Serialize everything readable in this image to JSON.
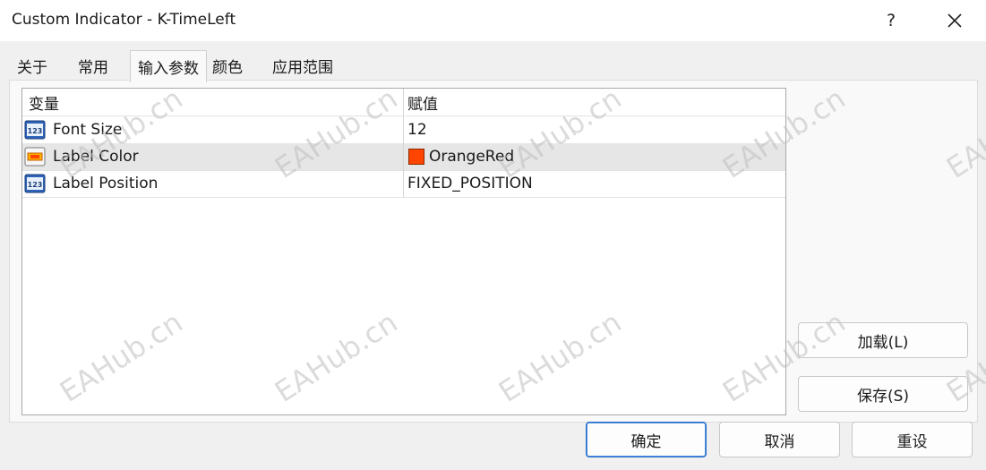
{
  "window": {
    "title": "Custom Indicator - K-TimeLeft",
    "help_label": "?"
  },
  "tabs": [
    {
      "label": "关于"
    },
    {
      "label": "常用"
    },
    {
      "label": "输入参数"
    },
    {
      "label": "颜色"
    },
    {
      "label": "应用范围"
    }
  ],
  "grid": {
    "columns": [
      "变量",
      "赋值"
    ],
    "rows": [
      {
        "name": "Font Size",
        "value": "12",
        "icon": "number-param-icon"
      },
      {
        "name": "Label Color",
        "value": "OrangeRed",
        "icon": "color-param-icon",
        "swatch": "#ff4500"
      },
      {
        "name": "Label Position",
        "value": "FIXED_POSITION",
        "icon": "number-param-icon"
      }
    ]
  },
  "side_buttons": {
    "load": "加载(L)",
    "save": "保存(S)"
  },
  "footer_buttons": {
    "ok": "确定",
    "cancel": "取消",
    "reset": "重设"
  },
  "watermark": "EAHub.cn",
  "colors": {
    "selected_row": "#e6e6e6",
    "swatch_orange_red": "#ff4500",
    "primary_border": "#2a6fc9"
  }
}
